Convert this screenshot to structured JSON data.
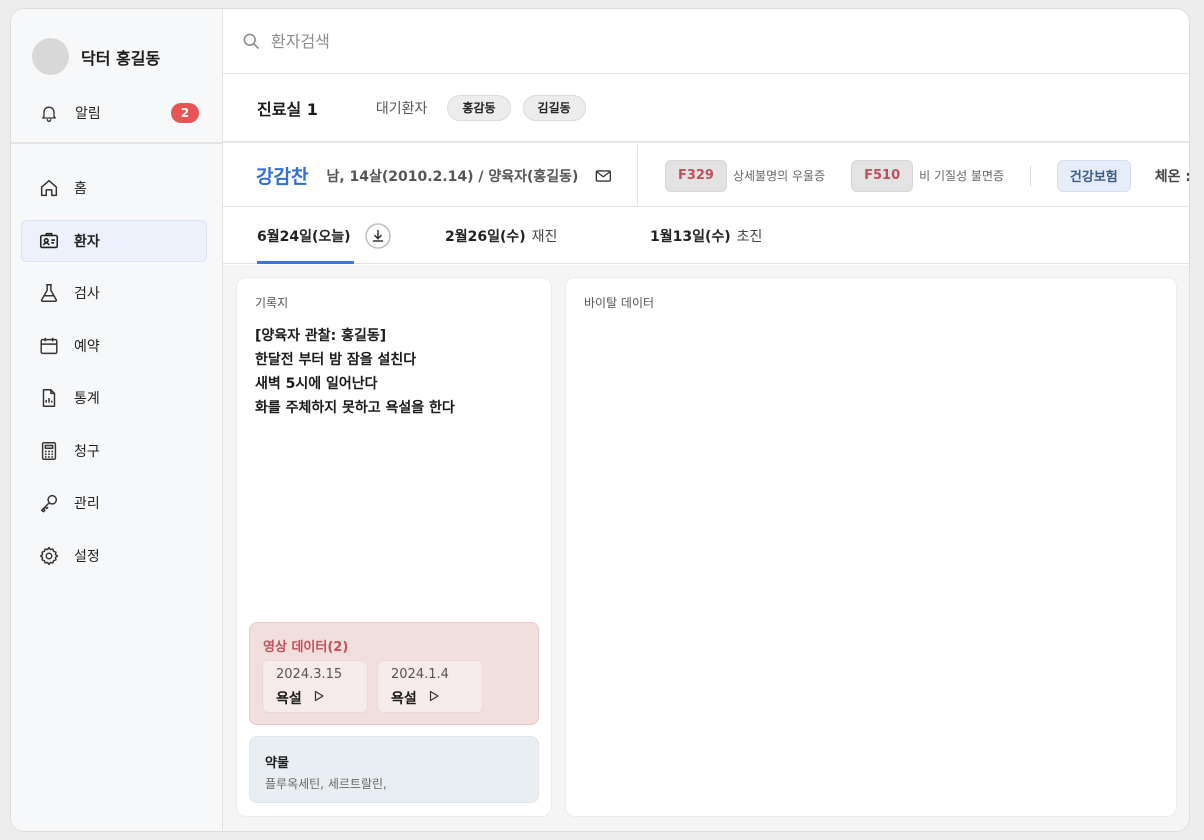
{
  "sidebar": {
    "doctor_name": "닥터 홍길동",
    "alarm": {
      "label": "알림",
      "count": "2"
    },
    "items": [
      {
        "label": "홈",
        "icon": "home-icon"
      },
      {
        "label": "환자",
        "icon": "patient-id-icon",
        "active": true
      },
      {
        "label": "검사",
        "icon": "flask-icon"
      },
      {
        "label": "예약",
        "icon": "calendar-icon"
      },
      {
        "label": "통계",
        "icon": "report-icon"
      },
      {
        "label": "청구",
        "icon": "calculator-icon"
      },
      {
        "label": "관리",
        "icon": "key-icon"
      },
      {
        "label": "설정",
        "icon": "gear-icon"
      }
    ]
  },
  "search": {
    "placeholder": "환자검색",
    "value": ""
  },
  "room": {
    "title": "진료실 1",
    "waiting_label": "대기환자",
    "waiting": [
      "홍감동",
      "김길동"
    ]
  },
  "patient": {
    "name": "강감찬",
    "info": "남, 14살(2010.2.14) / 양육자(홍길동)",
    "diagnoses": [
      {
        "code": "F329",
        "label": "상세불명의 우울증"
      },
      {
        "code": "F510",
        "label": "비 기질성 불면증"
      }
    ],
    "insurance": "건강보험",
    "temperature_label": "체온 :"
  },
  "tabs": [
    {
      "date": "6월24일(오늘)",
      "kind": ""
    },
    {
      "date": "2월26일(수)",
      "kind": "재진"
    },
    {
      "date": "1월13일(수)",
      "kind": "초진"
    }
  ],
  "record": {
    "title": "기록지",
    "lines": [
      "[양육자 관찰: 홍길동]",
      "한달전 부터 밤 잠을 설친다",
      "새벽 5시에 일어난다",
      "화를 주체하지 못하고 욕설을 한다"
    ],
    "video": {
      "title": "영상 데이터(2)",
      "items": [
        {
          "date": "2024.3.15",
          "label": "욕설"
        },
        {
          "date": "2024.1.4",
          "label": "욕설"
        }
      ]
    },
    "medication": {
      "title": "약물",
      "list": "플루옥세틴, 세르트랄린,"
    }
  },
  "vital": {
    "title": "바이탈 데이터"
  },
  "colors": {
    "accent": "#3a78d8",
    "patient_name": "#2f6fd6",
    "badge": "#e85454",
    "code_text": "#c0505a",
    "video_bg": "#f3dede",
    "insurance_bg": "#e4edf8"
  }
}
